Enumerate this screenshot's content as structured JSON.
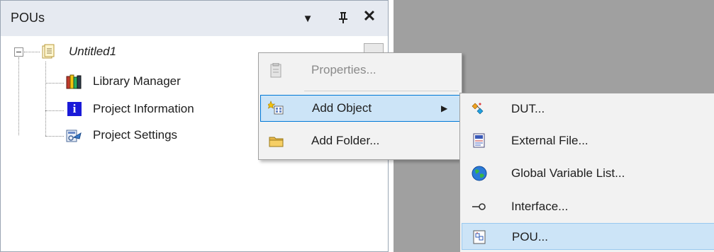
{
  "panel": {
    "title": "POUs",
    "dropdown_icon": "▼",
    "pin_icon": "ᚚ",
    "close_icon": "✕"
  },
  "tree": {
    "root": "Untitled1",
    "items": [
      {
        "label": "Library Manager",
        "icon": "library-books-icon"
      },
      {
        "label": "Project Information",
        "icon": "info-icon"
      },
      {
        "label": "Project Settings",
        "icon": "settings-doc-icon"
      }
    ]
  },
  "context_menu": {
    "items": [
      {
        "label": "Properties...",
        "icon": "properties-icon",
        "enabled": false
      },
      {
        "label": "Add Object",
        "icon": "add-object-icon",
        "highlighted": true,
        "submenu_arrow": "▶"
      },
      {
        "label": "Add Folder...",
        "icon": "folder-icon"
      }
    ]
  },
  "submenu": {
    "items": [
      {
        "label": "DUT...",
        "icon": "dut-icon"
      },
      {
        "label": "External File...",
        "icon": "external-file-icon"
      },
      {
        "label": "Global Variable List...",
        "icon": "globe-icon"
      },
      {
        "label": "Interface...",
        "icon": "interface-icon"
      },
      {
        "label": "POU...",
        "icon": "pou-icon",
        "highlighted": true
      }
    ]
  },
  "colors": {
    "accent": "#0078d7",
    "highlight": "#cce4f7",
    "workspace": "#a0a0a0"
  }
}
